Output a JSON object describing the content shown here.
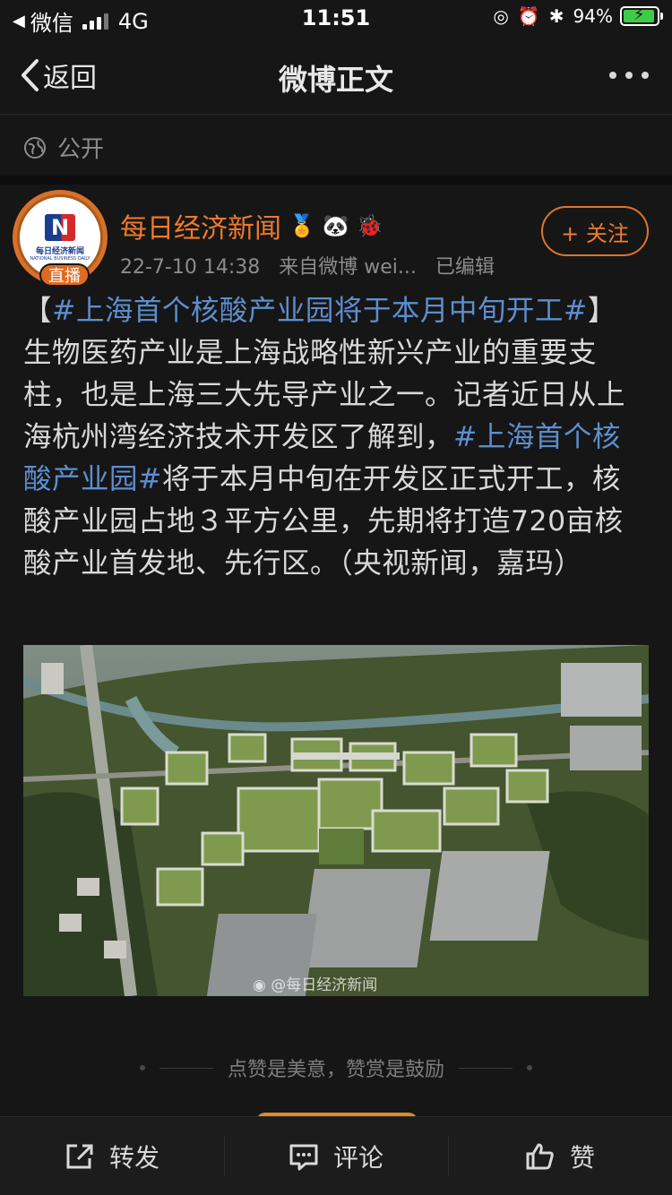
{
  "status_bar": {
    "carrier": "微信",
    "network": "4G",
    "time": "11:51",
    "battery": "94%",
    "battery_level": 0.94
  },
  "nav": {
    "back_label": "返回",
    "title": "微博正文"
  },
  "visibility": "公开",
  "author": {
    "name": "每日经济新闻",
    "live_badge": "直播",
    "avatar_logo_cn": "每日经济新闻",
    "avatar_logo_en": "NATIONAL BUSINESS DAILY",
    "date": "22-7-10 14:38",
    "source": "来自微博 wei...",
    "edited": "已编辑",
    "follow_label": "+ 关注"
  },
  "post": {
    "bracket_open": "【",
    "tag1": "#上海首个核酸产业园将于本月中旬开工#",
    "part1": "】 生物医药产业是上海战略性新兴产业的重要支柱，也是上海三大先导产业之一。记者近日从上海杭州湾经济技术开发区了解到，",
    "tag2": "#上海首个核酸产业园#",
    "part2": "将于本月中旬在开发区正式开工，核酸产业园占地３平方公里，先期将打造720亩核酸产业首发地、先行区。（央视新闻，嘉玛）",
    "image_watermark": "@每日经济新闻"
  },
  "reward_text": "点赞是美意，赞赏是鼓励",
  "toolbar": {
    "repost": "转发",
    "comment": "评论",
    "like": "赞"
  }
}
